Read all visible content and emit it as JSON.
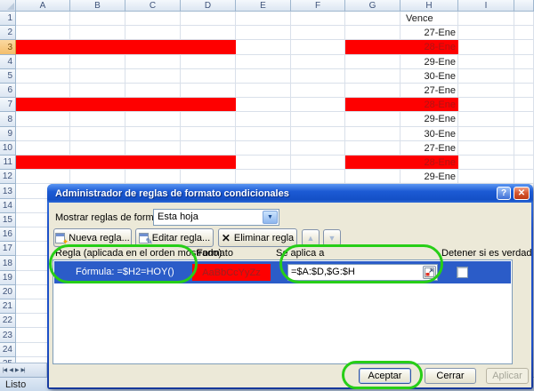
{
  "sheet": {
    "columns": [
      "A",
      "B",
      "C",
      "D",
      "E",
      "F",
      "G",
      "H",
      "I",
      ""
    ],
    "num_rows": 26,
    "active_row": 3,
    "red_rows": [
      3,
      7,
      11
    ],
    "red_column_ranges": [
      [
        "A",
        "D"
      ],
      [
        "G",
        "H"
      ]
    ],
    "h_values": {
      "1": "Vence",
      "2": "27-Ene",
      "3": "28-Ene",
      "4": "29-Ene",
      "5": "30-Ene",
      "6": "27-Ene",
      "7": "28-Ene",
      "8": "29-Ene",
      "9": "30-Ene",
      "10": "27-Ene",
      "11": "28-Ene",
      "12": "29-Ene"
    },
    "red_fill": "#FE0000",
    "red_text": "#B01313"
  },
  "dialog": {
    "title": "Administrador de reglas de formato condicionales",
    "show_label": "Mostrar reglas de formato para:",
    "scope_value": "Esta hoja",
    "toolbar": {
      "new_label": "Nueva regla...",
      "edit_label": "Editar regla...",
      "delete_label": "Eliminar regla"
    },
    "columns": {
      "rule": "Regla (aplicada en el orden mostrado)",
      "format": "Formato",
      "applies": "Se aplica a",
      "stop": "Detener si es verdad"
    },
    "rule": {
      "label": "Fórmula: =$H2=HOY()",
      "preview": "AaBbCcYyZz",
      "applies_to": "=$A:$D,$G:$H"
    },
    "footer": {
      "ok": "Aceptar",
      "close": "Cerrar",
      "apply": "Aplicar"
    }
  },
  "icons": {
    "help": "?",
    "close": "✕",
    "dropdown": "▼",
    "delete_x": "✕",
    "up": "▲",
    "down": "▼",
    "nav_first": "|◀",
    "nav_prev": "◀",
    "nav_next": "▶",
    "nav_last": "▶|"
  },
  "status": {
    "label": "Listo"
  },
  "annotation_color": "#27CE17",
  "selection_color": "#2B5CC8"
}
